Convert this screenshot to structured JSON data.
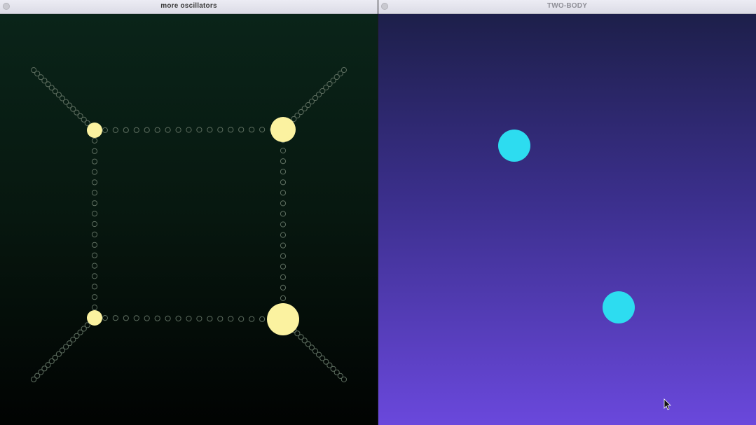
{
  "left_window": {
    "title": "more oscillators",
    "close_button": "close-icon",
    "colors": {
      "bob": "#fbf2a0",
      "link": "#5e6e60"
    }
  },
  "right_window": {
    "title": "TWO-BODY",
    "close_button": "close-icon",
    "colors": {
      "body": "#2ddcf0"
    }
  },
  "cursor": "arrow-cursor-icon"
}
